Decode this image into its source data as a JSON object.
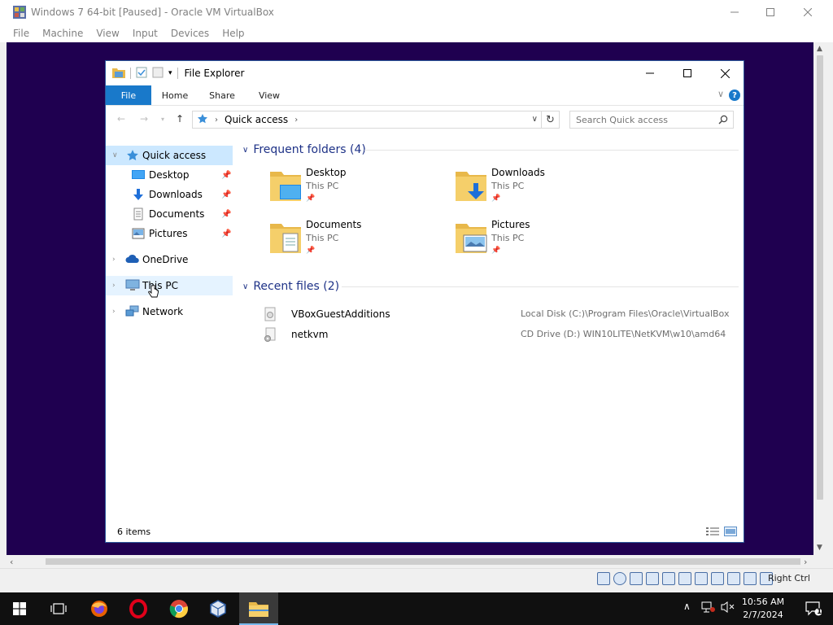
{
  "vbox": {
    "title": "Windows 7 64-bit [Paused] - Oracle VM VirtualBox",
    "menu": [
      "File",
      "Machine",
      "View",
      "Input",
      "Devices",
      "Help"
    ],
    "host_key": "Right Ctrl"
  },
  "explorer": {
    "title": "File Explorer",
    "ribbon_tabs": [
      "File",
      "Home",
      "Share",
      "View"
    ],
    "address": "Quick access",
    "search_placeholder": "Search Quick access",
    "nav": {
      "quick_access": "Quick access",
      "pinned": [
        "Desktop",
        "Downloads",
        "Documents",
        "Pictures"
      ],
      "onedrive": "OneDrive",
      "this_pc": "This PC",
      "network": "Network"
    },
    "frequent": {
      "header": "Frequent folders (4)",
      "folders": [
        {
          "name": "Desktop",
          "location": "This PC"
        },
        {
          "name": "Downloads",
          "location": "This PC"
        },
        {
          "name": "Documents",
          "location": "This PC"
        },
        {
          "name": "Pictures",
          "location": "This PC"
        }
      ]
    },
    "recent": {
      "header": "Recent files (2)",
      "files": [
        {
          "name": "VBoxGuestAdditions",
          "path": "Local Disk (C:)\\Program Files\\Oracle\\VirtualBox"
        },
        {
          "name": "netkvm",
          "path": "CD Drive (D:) WIN10LITE\\NetKVM\\w10\\amd64"
        }
      ]
    },
    "status": "6 items"
  },
  "taskbar": {
    "time": "10:56 AM",
    "date": "2/7/2024",
    "notifications": "1"
  },
  "colors": {
    "vm_background": "#1f0050",
    "ribbon_file": "#1979ca",
    "nav_selected": "#cce8ff",
    "group_header": "#1e3287",
    "taskbar": "#101010"
  }
}
